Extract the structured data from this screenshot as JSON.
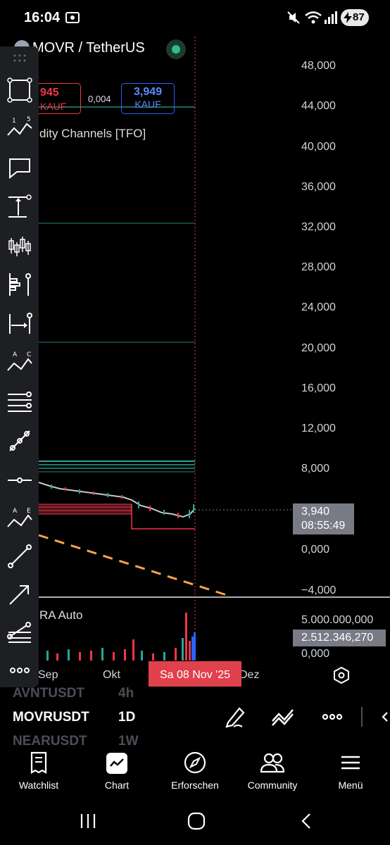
{
  "status": {
    "time": "16:04",
    "battery": "87"
  },
  "chart": {
    "symbol": "MOVR / TetherUS",
    "sell_price": "945",
    "sell_label": "KAUF",
    "spread": "0,004",
    "buy_price": "3,949",
    "buy_label": "KAUF",
    "indicator_name": "dity Channels [TFO]",
    "volume_indicator": "RA Auto",
    "price_axis": [
      "48,000",
      "44,000",
      "40,000",
      "36,000",
      "32,000",
      "28,000",
      "24,000",
      "20,000",
      "16,000",
      "12,000",
      "8,000",
      "0,000",
      "−4,000"
    ],
    "current_price": "3,940",
    "countdown": "08:55:49",
    "volume_axis": [
      "5.000.000,000",
      "0,000"
    ],
    "current_volume": "2.512.346,270",
    "time_axis": [
      "Sep",
      "Okt",
      "Dez"
    ],
    "cursor_date": "Sa 08 Nov '25"
  },
  "watchlist": {
    "rows": [
      {
        "symbol": "AVNTUSDT",
        "interval": "4h"
      },
      {
        "symbol": "MOVRUSDT",
        "interval": "1D"
      },
      {
        "symbol": "NEARUSDT",
        "interval": "1W"
      }
    ]
  },
  "nav": {
    "watchlist": "Watchlist",
    "chart": "Chart",
    "explore": "Erforschen",
    "community": "Community",
    "menu": "Menü"
  },
  "colors": {
    "sell": "#f23645",
    "buy": "#2962ff",
    "cursor": "#e0414d",
    "channel": "#26a69a",
    "trend": "#f7a546"
  }
}
